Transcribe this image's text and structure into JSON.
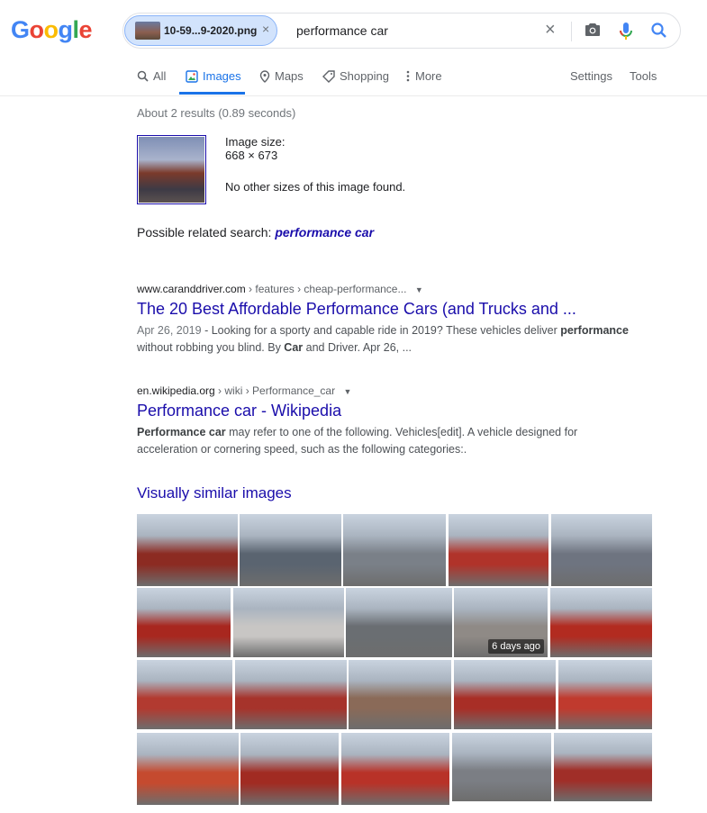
{
  "logo": {
    "letters": [
      "G",
      "o",
      "o",
      "g",
      "l",
      "e"
    ],
    "colors": [
      "#4285f4",
      "#ea4335",
      "#fbbc05",
      "#4285f4",
      "#34a853",
      "#ea4335"
    ]
  },
  "search": {
    "chip_label": "10-59...9-2020.png",
    "chip_close": "×",
    "query": "performance car",
    "clear": "×"
  },
  "tabs": [
    {
      "label": "All",
      "icon": "search-icon"
    },
    {
      "label": "Images",
      "icon": "image-icon"
    },
    {
      "label": "Maps",
      "icon": "map-pin-icon"
    },
    {
      "label": "Shopping",
      "icon": "tag-icon"
    },
    {
      "label": "More",
      "icon": "more-vert-icon"
    }
  ],
  "tools": {
    "settings": "Settings",
    "tools": "Tools"
  },
  "stats": "About 2 results (0.89 seconds)",
  "image_info": {
    "size_label": "Image size:",
    "size_value": "668 × 673",
    "no_sizes": "No other sizes of this image found."
  },
  "related": {
    "prefix": "Possible related search: ",
    "term": "performance car"
  },
  "results": [
    {
      "domain": "www.caranddriver.com",
      "crumbs": " › features › cheap-performance...",
      "title": "The 20 Best Affordable Performance Cars (and Trucks and ...",
      "date": "Apr 26, 2019",
      "snippet_a": " - Looking for a sporty and capable ride in 2019? These vehicles deliver ",
      "snippet_b": "performance",
      "snippet_c": " without robbing you blind. By ",
      "snippet_d": "Car",
      "snippet_e": " and Driver. Apr 26, ..."
    },
    {
      "domain": "en.wikipedia.org",
      "crumbs": " › wiki › Performance_car",
      "title": "Performance car - Wikipedia",
      "snippet_b": "Performance car",
      "snippet_c": " may refer to one of the following. Vehicles[edit]. A vehicle designed for acceleration or cornering speed, such as the following categories:."
    }
  ],
  "similar": {
    "heading": "Visually similar images",
    "badge": "6 days ago",
    "rows": [
      [
        "#8c2b22",
        "#5a6470",
        "#7a8088",
        "#b0332a",
        "#6e7480"
      ],
      [
        "#a8271f",
        "#c8c6c4",
        "#6a6e72",
        "#8f8a86",
        "#b22b20"
      ],
      [
        "#b23a30",
        "#a6332b",
        "#8a6a58",
        "#a82e26",
        "#c03a2e"
      ],
      [
        "#c54a2f",
        "#a12b22",
        "#b83228",
        "#7b7e84",
        "#a02e28"
      ]
    ]
  }
}
